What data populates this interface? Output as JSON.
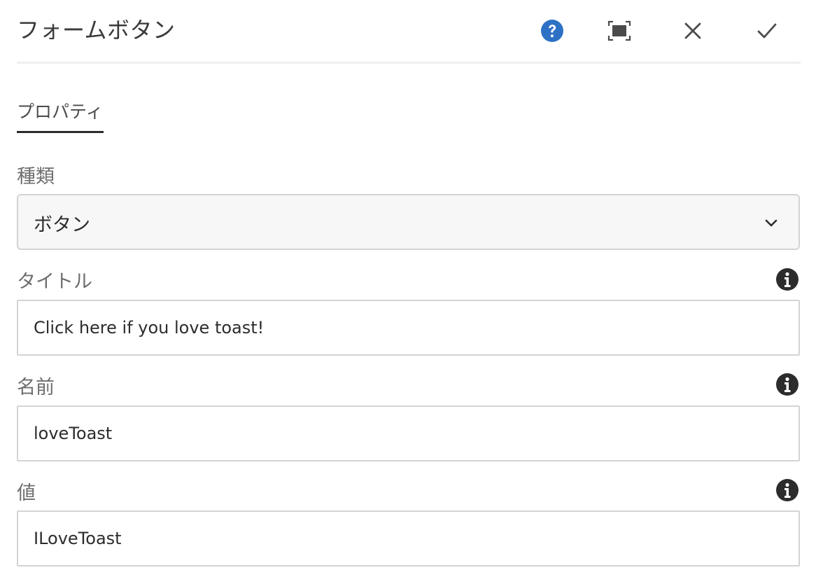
{
  "dialog": {
    "title": "フォームボタン",
    "accent_color": "#2d71c5"
  },
  "header_buttons": {
    "help_icon": "question-circle-icon",
    "fullscreen_icon": "fullscreen-icon",
    "cancel_icon": "close-icon",
    "done_icon": "checkmark-icon"
  },
  "tabs": [
    {
      "label": "プロパティ",
      "active": true
    }
  ],
  "fields": {
    "type": {
      "label": "種類",
      "value": "ボタン"
    },
    "title": {
      "label": "タイトル",
      "value": "Click here if you love toast!"
    },
    "name": {
      "label": "名前",
      "value": "loveToast"
    },
    "value": {
      "label": "値",
      "value": "ILoveToast"
    }
  }
}
